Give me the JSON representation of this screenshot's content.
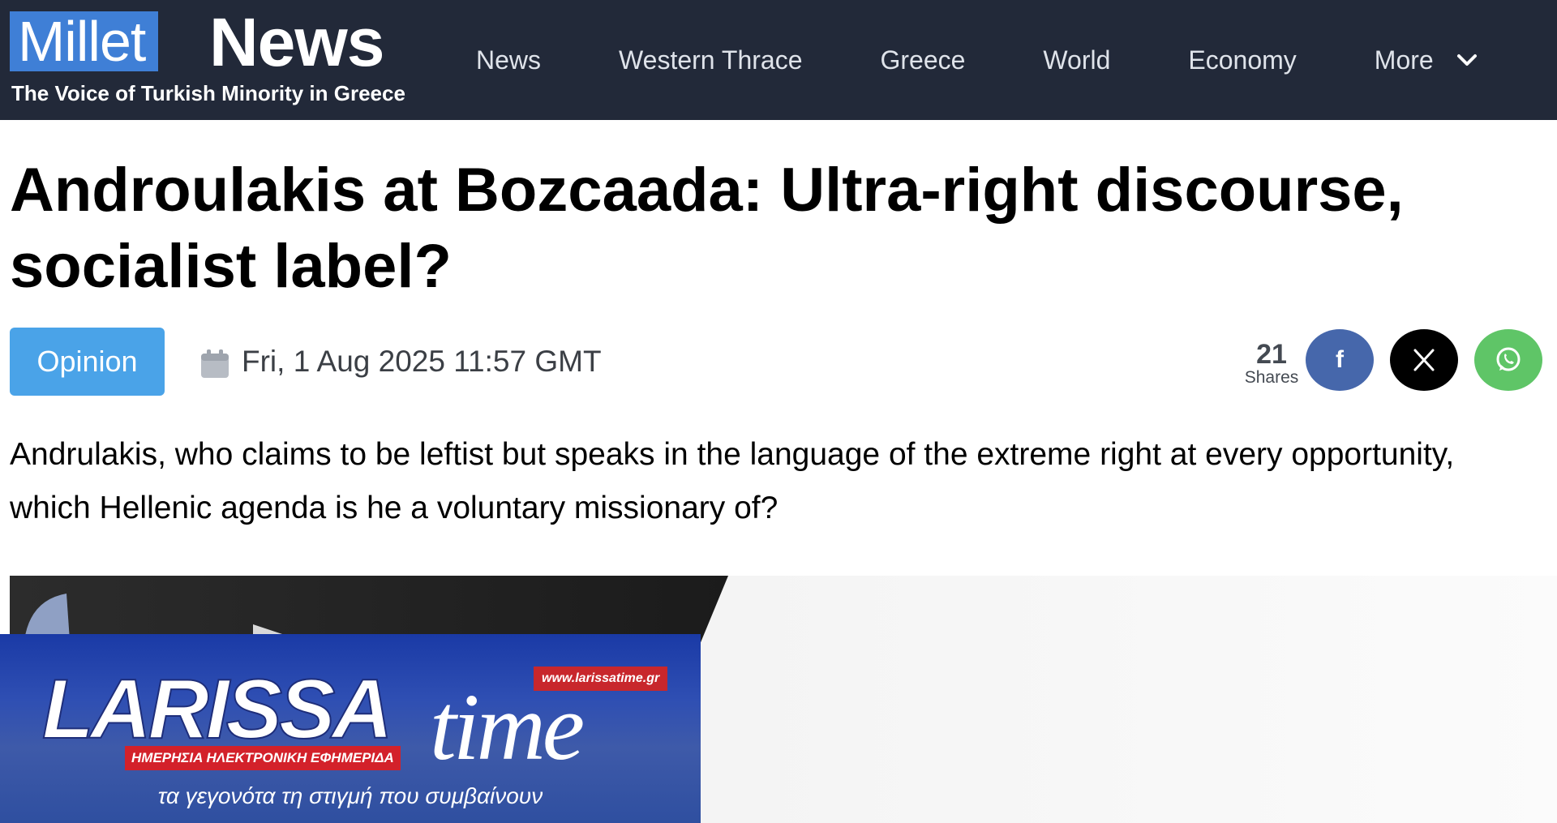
{
  "site": {
    "logo_millet": "Millet",
    "logo_news": "News",
    "tagline": "The Voice of Turkish Minority in Greece"
  },
  "nav": {
    "items": [
      {
        "label": "News"
      },
      {
        "label": "Western Thrace"
      },
      {
        "label": "Greece"
      },
      {
        "label": "World"
      },
      {
        "label": "Economy"
      }
    ],
    "more_label": "More",
    "more_icon": "chevron-down-icon"
  },
  "article": {
    "title": "Androulakis at Bozcaada: Ultra-right discourse, socialist label?",
    "category": "Opinion",
    "date_icon": "calendar-icon",
    "date": "Fri, 1 Aug 2025 11:57 GMT",
    "shares": {
      "count": "21",
      "label": "Shares"
    },
    "share_buttons": [
      {
        "network": "facebook",
        "icon": "facebook-icon",
        "color": "#4667ab"
      },
      {
        "network": "x",
        "icon": "x-icon",
        "color": "#000000"
      },
      {
        "network": "whatsapp",
        "icon": "whatsapp-icon",
        "color": "#5fc567"
      }
    ],
    "lead": "Andrulakis, who claims to be leftist but speaks in the language of the extreme right at every opportunity, which Hellenic agenda is he a voluntary missionary of?"
  },
  "watermark": {
    "brand": "LARISSA",
    "brand_suffix": "time",
    "url": "www.larissatime.gr",
    "subtitle": "ΗΜΕΡΗΣΙΑ ΗΛΕΚΤΡΟΝΙΚΗ ΕΦΗΜΕΡΙΔΑ",
    "slogan": "τα γεγονότα τη στιγμή που συμβαίνουν"
  },
  "colors": {
    "header_bg": "#222939",
    "logo_blue": "#3f7fd6",
    "badge_blue": "#4aa3e8",
    "facebook": "#4667ab",
    "x": "#000000",
    "whatsapp": "#5fc567",
    "larissa_red": "#d3212a"
  }
}
